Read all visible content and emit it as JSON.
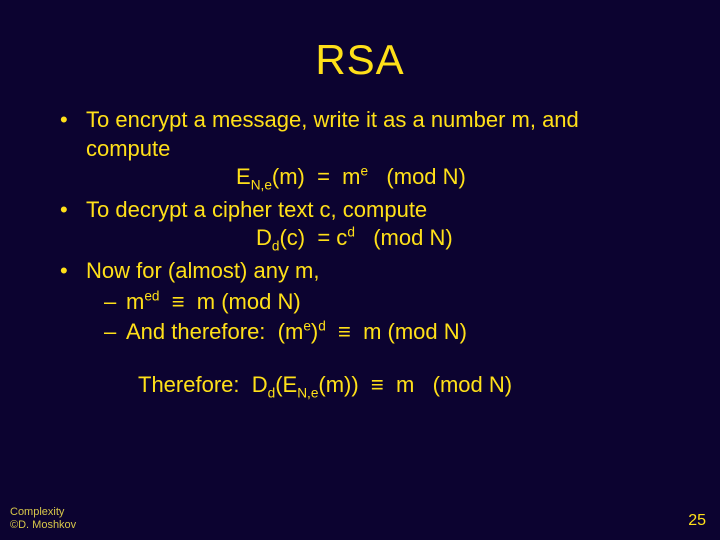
{
  "title": "RSA",
  "bullets": {
    "b1_lead": "To encrypt a message, write it as a number m, and compute",
    "b1_eq_pre": "E",
    "b1_eq_sub": "N,e",
    "b1_eq_mid": "(m)  =  m",
    "b1_eq_sup": "e",
    "b1_eq_tail": "   (mod N)",
    "b2_lead": "To decrypt a cipher text c, compute",
    "b2_eq_pre": "D",
    "b2_eq_sub": "d",
    "b2_eq_mid": "(c)  = c",
    "b2_eq_sup": "d",
    "b2_eq_tail": "   (mod N)",
    "b3_lead": "Now for (almost) any m,",
    "b3_s1_m": "m",
    "b3_s1_sup": "ed",
    "b3_s1_tail": "  ≡  m (mod N)",
    "b3_s2_lead": "And therefore:  (m",
    "b3_s2_sup1": "e",
    "b3_s2_mid": ")",
    "b3_s2_sup2": "d",
    "b3_s2_tail": "  ≡  m (mod N)"
  },
  "conclusion": {
    "lead": "Therefore:  D",
    "dsub": "d",
    "mid1": "(E",
    "esub": "N,e",
    "mid2": "(m))  ≡  m   (mod N)"
  },
  "footer": {
    "line1": "Complexity",
    "line2": "©D. Moshkov",
    "page": "25"
  }
}
